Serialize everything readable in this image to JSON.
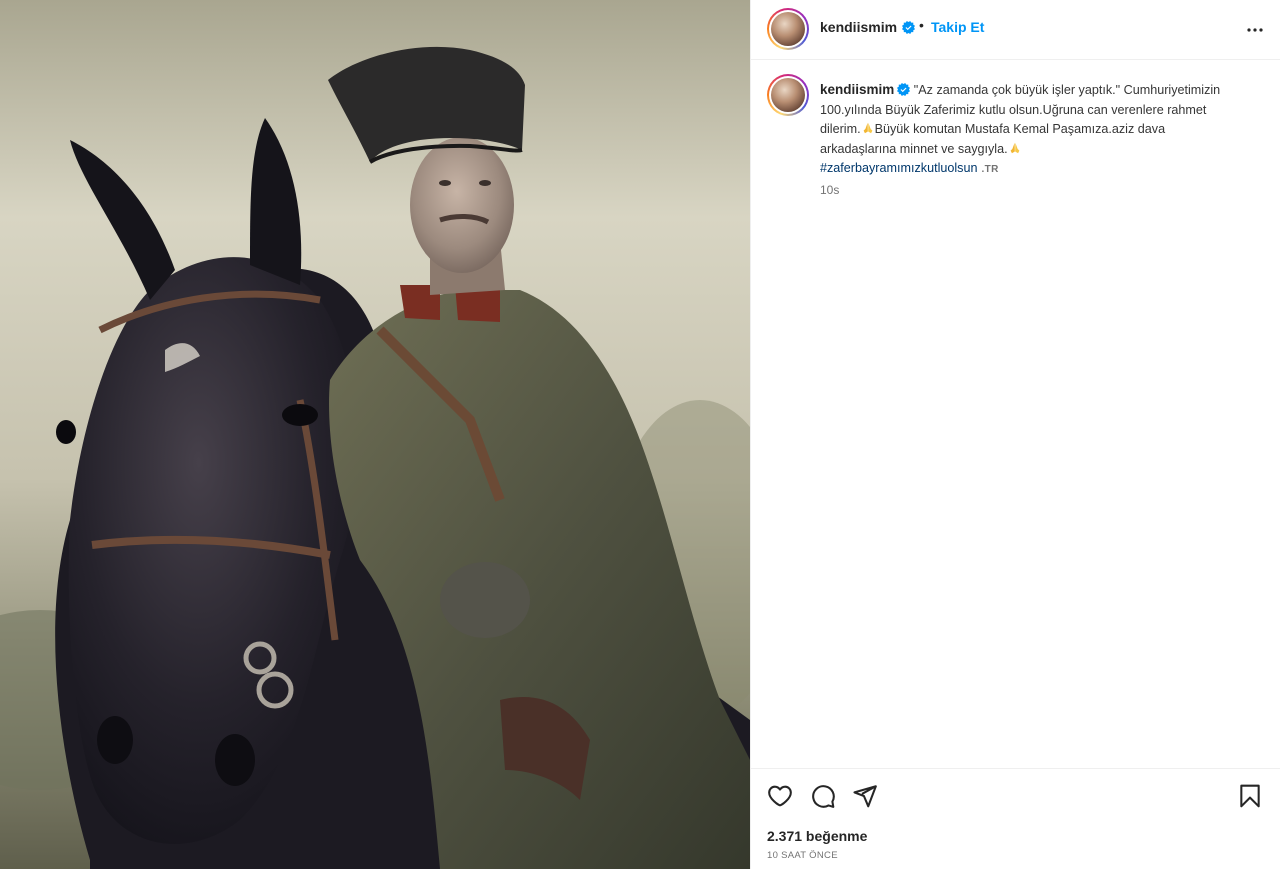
{
  "post": {
    "username": "kendiismim",
    "separator": "•",
    "follow_label": "Takip Et",
    "more_icon": "more-horizontal-icon",
    "verified_icon": "verified-badge-icon"
  },
  "caption": {
    "username": "kendiismim",
    "part1": "\"Az zamanda çok büyük işler yaptık.\" Cumhuriyetimizin 100.yılında Büyük Zaferimiz kutlu olsun.Uğruna can verenlere rahmet dilerim.",
    "part2": "Büyük komutan Mustafa Kemal Paşamıza.aziz dava arkadaşlarına minnet ve saygıyla.",
    "emoji_icon": "folded-hands-icon",
    "hashtag": "#zaferbayramımızkutluolsun",
    "tag": ".TR",
    "time": "10s"
  },
  "actions": {
    "like_icon": "heart-icon",
    "comment_icon": "comment-icon",
    "share_icon": "share-icon",
    "save_icon": "bookmark-icon",
    "likes_text": "2.371 beğenme",
    "time_text": "10 SAAT ÖNCE"
  },
  "colors": {
    "accent": "#0095f6",
    "hashtag": "#00376b",
    "secondary_text": "#737373",
    "border": "#efefef"
  }
}
